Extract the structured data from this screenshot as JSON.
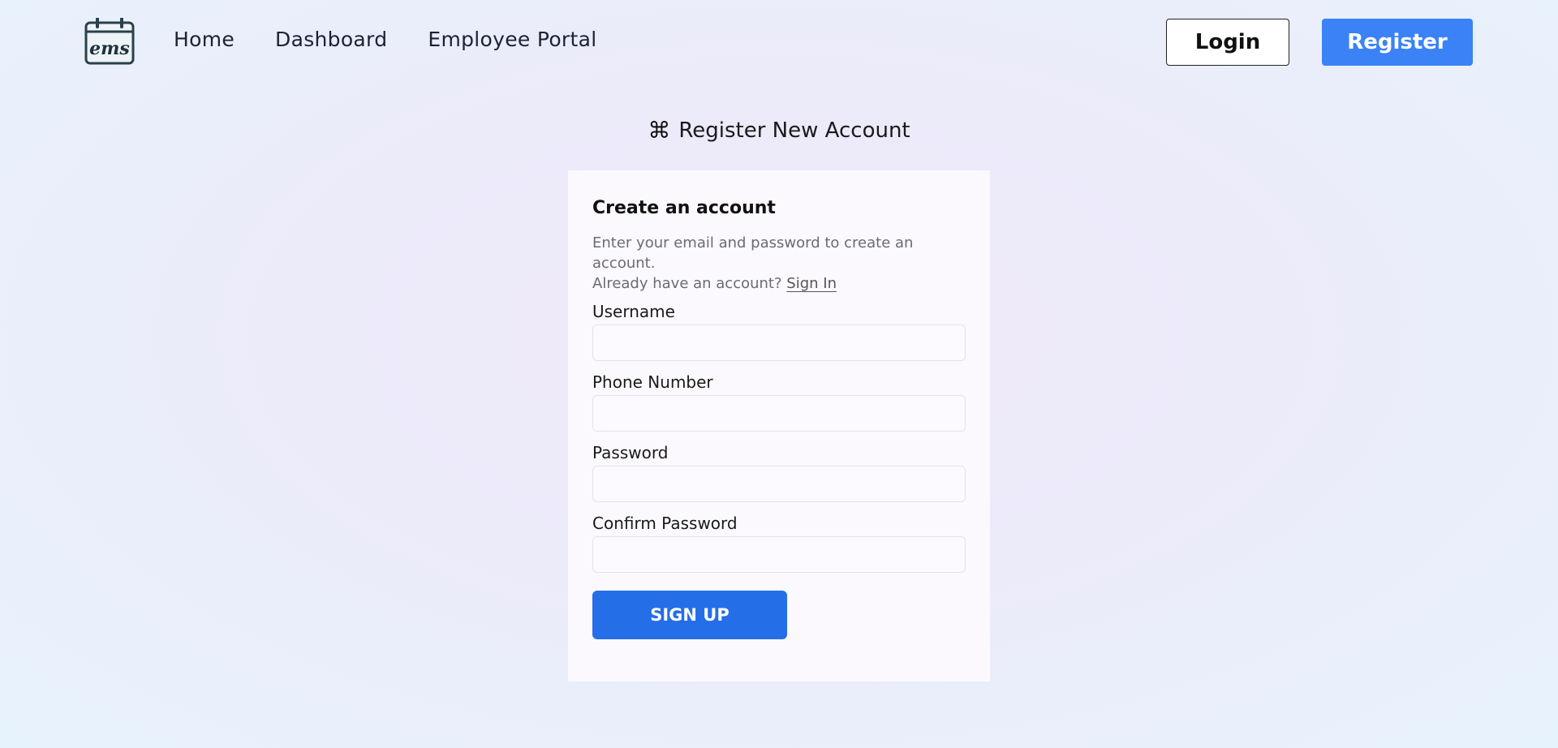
{
  "nav": {
    "logo_text": "ems",
    "links": [
      "Home",
      "Dashboard",
      "Employee Portal"
    ],
    "login_label": "Login",
    "register_label": "Register"
  },
  "page": {
    "heading": "Register New Account",
    "heading_icon": "command-icon"
  },
  "form": {
    "title": "Create an account",
    "description": "Enter your email and password to create an account.",
    "signin_prompt": "Already have an account?",
    "signin_link": "Sign In",
    "fields": [
      {
        "label": "Username",
        "value": ""
      },
      {
        "label": "Phone Number",
        "value": ""
      },
      {
        "label": "Password",
        "value": ""
      },
      {
        "label": "Confirm Password",
        "value": ""
      }
    ],
    "submit_label": "SIGN UP"
  },
  "colors": {
    "accent": "#3b82f6",
    "submit": "#246ee8"
  }
}
